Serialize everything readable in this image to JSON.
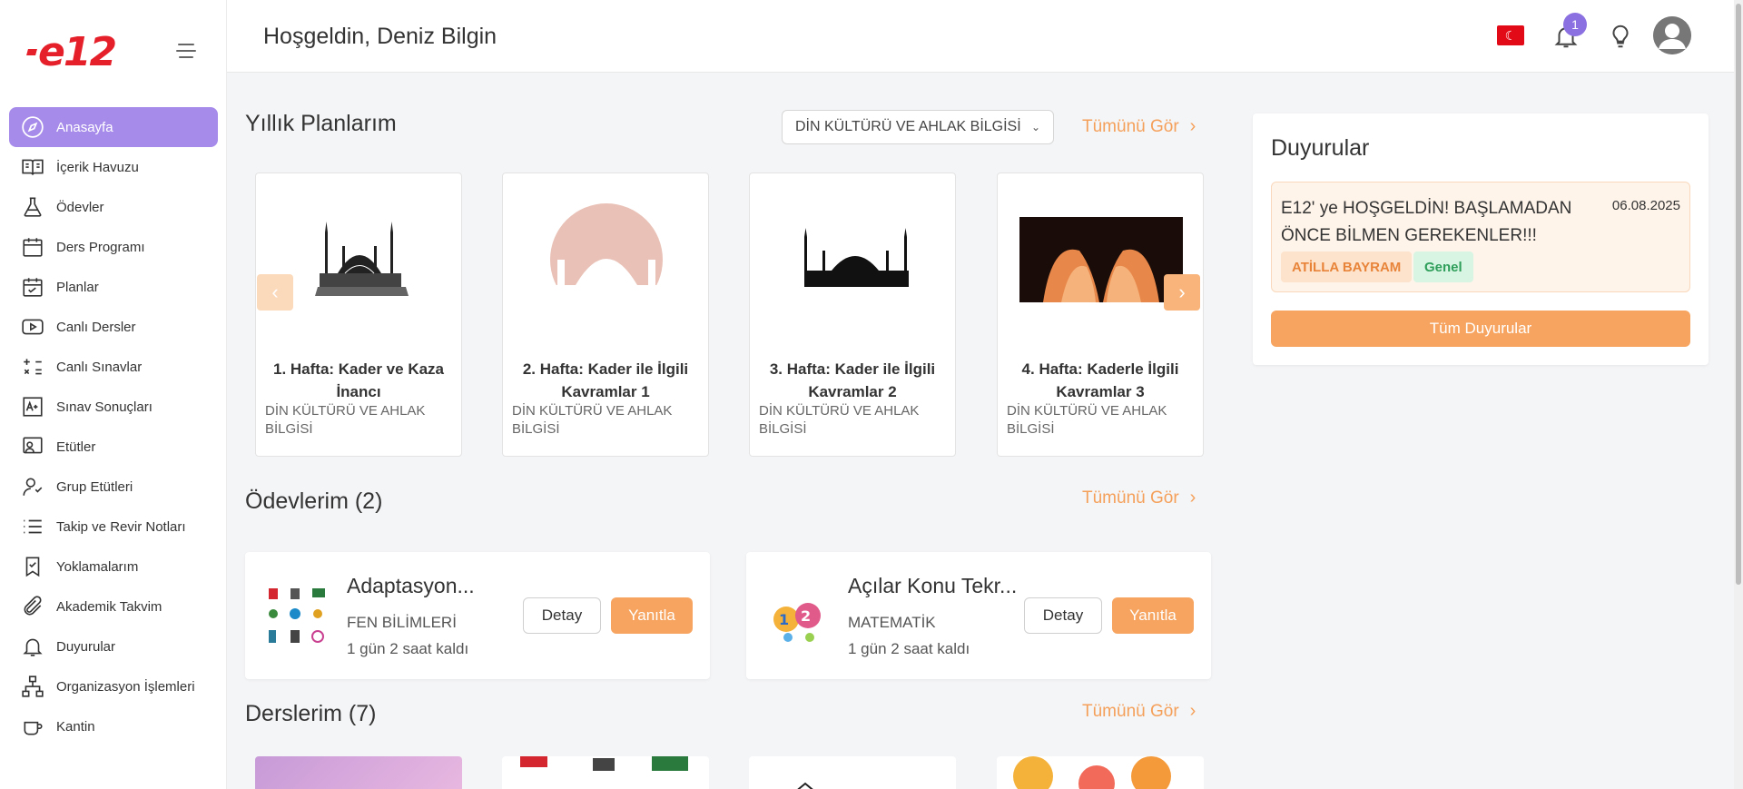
{
  "app": {
    "logo_text": "e12"
  },
  "header": {
    "greeting": "Hoşgeldin, Deniz Bilgin",
    "notification_count": "1"
  },
  "sidebar": {
    "items": [
      {
        "label": "Anasayfa",
        "icon": "compass-icon",
        "active": true
      },
      {
        "label": "İçerik Havuzu",
        "icon": "book-open-icon"
      },
      {
        "label": "Ödevler",
        "icon": "flask-icon"
      },
      {
        "label": "Ders Programı",
        "icon": "calendar-icon"
      },
      {
        "label": "Planlar",
        "icon": "calendar-check-icon"
      },
      {
        "label": "Canlı Dersler",
        "icon": "play-icon"
      },
      {
        "label": "Canlı Sınavlar",
        "icon": "calculator-icon"
      },
      {
        "label": "Sınav Sonuçları",
        "icon": "grade-icon"
      },
      {
        "label": "Etütler",
        "icon": "presentation-icon"
      },
      {
        "label": "Grup Etütleri",
        "icon": "user-group-icon"
      },
      {
        "label": "Takip ve Revir Notları",
        "icon": "list-icon"
      },
      {
        "label": "Yoklamalarım",
        "icon": "bookmark-check-icon"
      },
      {
        "label": "Akademik Takvim",
        "icon": "paperclip-icon"
      },
      {
        "label": "Duyurular",
        "icon": "bell-icon"
      },
      {
        "label": "Organizasyon İşlemleri",
        "icon": "org-chart-icon"
      },
      {
        "label": "Kantin",
        "icon": "cup-icon"
      }
    ]
  },
  "plans": {
    "title": "Yıllık Planlarım",
    "subject_select": "DİN KÜLTÜRÜ VE AHLAK BİLGİSİ",
    "see_all": "Tümünü Gör",
    "cards": [
      {
        "title": "1. Hafta: Kader ve Kaza İnancı",
        "subject": "DİN KÜLTÜRÜ VE AHLAK BİLGİSİ",
        "image": "mosque-sketch"
      },
      {
        "title": "2. Hafta: Kader ile İlgili Kavramlar 1",
        "subject": "DİN KÜLTÜRÜ VE AHLAK BİLGİSİ",
        "image": "mosque-pink-silhouette"
      },
      {
        "title": "3. Hafta: Kader ile İlgili Kavramlar 2",
        "subject": "DİN KÜLTÜRÜ VE AHLAK BİLGİSİ",
        "image": "mosque-black-silhouette"
      },
      {
        "title": "4. Hafta: Kaderle İlgili Kavramlar 3",
        "subject": "DİN KÜLTÜRÜ VE AHLAK BİLGİSİ",
        "image": "praying-hands"
      }
    ]
  },
  "homework": {
    "title": "Ödevlerim (2)",
    "see_all": "Tümünü Gör",
    "detail_label": "Detay",
    "reply_label": "Yanıtla",
    "items": [
      {
        "name": "Adaptasyon...",
        "subject": "FEN BİLİMLERİ",
        "time": "1 gün 2 saat kaldı"
      },
      {
        "name": "Açılar Konu Tekr...",
        "subject": "MATEMATİK",
        "time": "1 gün 2 saat kaldı"
      }
    ]
  },
  "courses": {
    "title": "Derslerim (7)",
    "see_all": "Tümünü Gör"
  },
  "announcements": {
    "title": "Duyurular",
    "items": [
      {
        "text": "E12' ye HOŞGELDİN! BAŞLAMADAN ÖNCE BİLMEN GEREKENLER!!!",
        "date": "06.08.2025",
        "author": "ATİLLA BAYRAM",
        "category": "Genel"
      }
    ],
    "all_button": "Tüm Duyurular"
  },
  "colors": {
    "accent": "#f6a45f",
    "active_nav": "#a78bea",
    "brand": "#e5202a",
    "badge": "#8a70e0"
  }
}
